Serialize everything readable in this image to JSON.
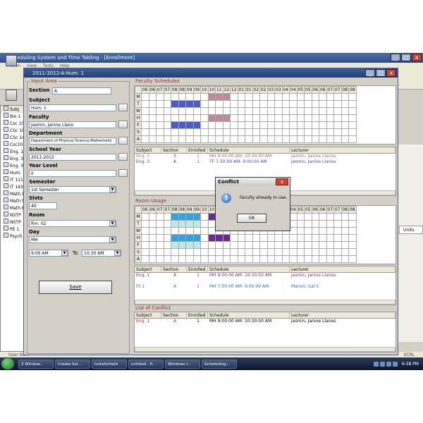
{
  "app": {
    "title": "Scheduling System and Time Tabling - [Enrollment]",
    "menu": [
      "Action",
      "View",
      "Tools",
      "Help"
    ],
    "min": "_",
    "max": "□",
    "close": "x"
  },
  "left_tree": {
    "header": "Subj",
    "items": [
      "Bio 1",
      "Csc 10",
      "CSc 10",
      "CSc 14",
      "Csc10",
      "Eng. 1",
      "Eng. 3",
      "Eng. 3",
      "Hum. 1",
      "IT 111",
      "IT 143",
      "Math 1",
      "Math 5",
      "Math 6",
      "NSTP",
      "NSTP",
      "PE 1",
      "Psych"
    ]
  },
  "right_units": "Units",
  "status_left": "User Na...",
  "status_right": "SCRL",
  "child_window": {
    "title": "2011-2012-A-Hum. 1",
    "input_area": {
      "title": "Input Area",
      "section_label": "Section",
      "section_value": "A",
      "subject_label": "Subject",
      "subject_value": "Hum. 1",
      "faculty_label": "Faculty",
      "faculty_value": "Jasmin, Janine Llano",
      "department_label": "Department",
      "department_value": "Department of Physical Science,Mathematic",
      "school_year_label": "School Year",
      "school_year_value": "2011-2012",
      "year_level_label": "Year Level",
      "year_level_value": "II",
      "semester_label": "Semester",
      "semester_value": "1st Semester",
      "slots_label": "Slots",
      "slots_value": "40",
      "room_label": "Room",
      "room_value": "Rm. 02",
      "day_label": "Day",
      "day_value": "MH",
      "time_from": "9:00 AM",
      "to_label": "To",
      "time_to": "10:30 AM",
      "save_label": "Save"
    },
    "faculty_schedules": {
      "title": "Faculty Schedules",
      "hours": [
        "06",
        "06",
        "07",
        "07",
        "08",
        "08",
        "09",
        "09",
        "10",
        "10",
        "11",
        "12",
        "12",
        "01",
        "01",
        "02",
        "02",
        "03",
        "03",
        "04",
        "04",
        "05",
        "05",
        "06",
        "06",
        "07",
        "07",
        "08",
        "08"
      ],
      "days": [
        "M",
        "T",
        "W",
        "H",
        "F",
        "S",
        "A"
      ],
      "blocks": [
        {
          "row": 0,
          "start": 9,
          "end": 12,
          "color": "#b98c98"
        },
        {
          "row": 1,
          "start": 4,
          "end": 8,
          "color": "#4b5cc8"
        },
        {
          "row": 3,
          "start": 9,
          "end": 12,
          "color": "#b98c98"
        },
        {
          "row": 4,
          "start": 4,
          "end": 8,
          "color": "#4b5cc8"
        }
      ],
      "columns": [
        "Subject",
        "Section",
        "Enrolled",
        "Schedule",
        "Lecturer"
      ],
      "rows": [
        {
          "subject": "Eng. 1",
          "section": "A",
          "enrolled": "1",
          "schedule": "MH 9:00:00 AM- 10:30:00 AM",
          "lecturer": "Jasmin, Janine Llanos",
          "color": "#b06080"
        },
        {
          "subject": "Eng. 3",
          "section": "A",
          "enrolled": "1",
          "schedule": "TF 7:30:00 AM- 9:00:00 AM",
          "lecturer": "Jasmin, Janine Llanos",
          "color": "#3a4fb0"
        }
      ]
    },
    "room_usage": {
      "title": "Room Usage",
      "hours": [
        "06",
        "06",
        "07",
        "07",
        "08",
        "08",
        "09",
        "09",
        "10",
        "10",
        "11",
        "12",
        "12",
        "01",
        "01",
        "02",
        "02",
        "03",
        "03",
        "04",
        "04",
        "05",
        "05",
        "06",
        "06",
        "07",
        "07",
        "08",
        "08"
      ],
      "days": [
        "M",
        "T",
        "W",
        "H",
        "F",
        "S",
        "A"
      ],
      "blocks": [
        {
          "row": 0,
          "start": 4,
          "end": 8,
          "color": "#33a0e0"
        },
        {
          "row": 0,
          "start": 9,
          "end": 12,
          "color": "#6a2a90"
        },
        {
          "row": 1,
          "start": 4,
          "end": 8,
          "color": "#bfe8e8"
        },
        {
          "row": 3,
          "start": 4,
          "end": 8,
          "color": "#33a0e0"
        },
        {
          "row": 3,
          "start": 9,
          "end": 12,
          "color": "#6a2a90"
        },
        {
          "row": 4,
          "start": 4,
          "end": 8,
          "color": "#bfe8e8"
        }
      ],
      "columns": [
        "Subject",
        "Section",
        "Enrolled",
        "Schedule",
        "Lecturer"
      ],
      "rows": [
        {
          "subject": "Eng. 1",
          "section": "A",
          "enrolled": "1",
          "schedule": "MH 9:00:00 AM- 10:30:00 AM",
          "lecturer": "Jasmin, Janine Llanos",
          "color": "#7a2a9a"
        },
        {
          "subject": "",
          "section": "",
          "enrolled": "",
          "schedule": "",
          "lecturer": "",
          "color": "#7ad0d0"
        },
        {
          "subject": "Fil 1",
          "section": "A",
          "enrolled": "1",
          "schedule": "MH 7:30:00 AM- 9:00:00 AM",
          "lecturer": "Maroni, Sal S",
          "color": "#2a70c0"
        }
      ]
    },
    "list_of_conflict": {
      "title": "List of Conflict",
      "columns": [
        "Subject",
        "Section",
        "Enrolled",
        "Schedule",
        "Lecturer"
      ],
      "rows": [
        {
          "subject": "Eng. 1",
          "section": "A",
          "enrolled": "1",
          "schedule": "MH 9:00:00 AM- 10:30:00 AM",
          "lecturer": "Jasmin, Janine Llanos"
        }
      ]
    }
  },
  "dialog": {
    "title": "Conflict",
    "close": "x",
    "icon": "i",
    "message": "Faculty already in use.",
    "ok_label": "OK"
  },
  "taskbar": {
    "items": [
      "2 Window...",
      "Create Sol...",
      "Installshield",
      "untitled - P...",
      "Windows I...",
      "Scheduling..."
    ],
    "clock": "6:38 PM"
  }
}
